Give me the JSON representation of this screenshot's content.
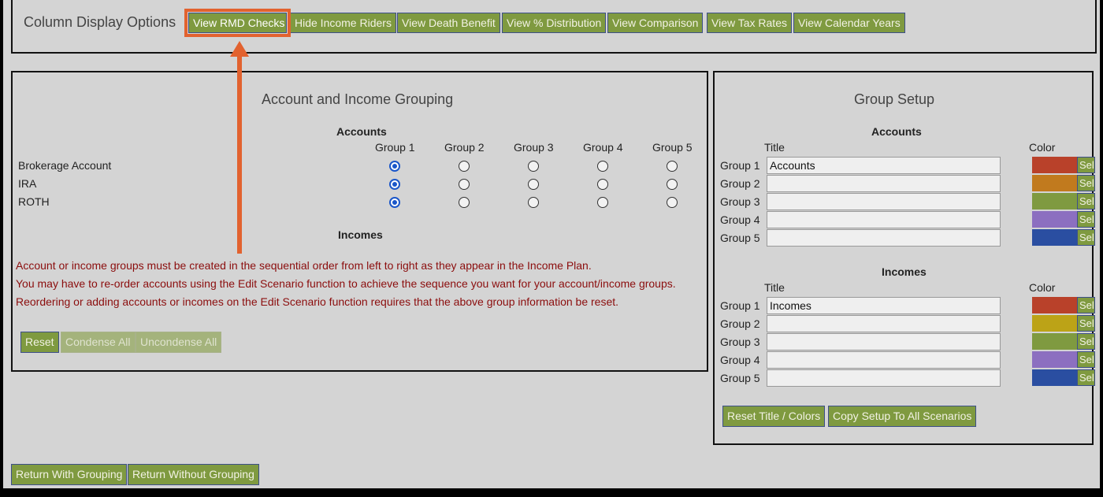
{
  "top_bar": {
    "label": "Column Display Options",
    "buttons": [
      "View RMD Checks",
      "Hide Income Riders",
      "View Death Benefit",
      "View % Distribution",
      "View Comparison",
      "View Tax Rates",
      "View Calendar Years"
    ]
  },
  "grouping": {
    "title": "Account and Income Grouping",
    "accounts_header": "Accounts",
    "group_headers": [
      "Group 1",
      "Group 2",
      "Group 3",
      "Group 4",
      "Group 5"
    ],
    "rows": [
      {
        "name": "Brokerage Account",
        "selected": 1
      },
      {
        "name": "IRA",
        "selected": 1
      },
      {
        "name": "ROTH",
        "selected": 1
      }
    ],
    "incomes_header": "Incomes",
    "warnings": [
      "Account or income groups must be created in the sequential order from left to right as they appear in the Income Plan.",
      "You may have to re-order accounts using the Edit Scenario function to achieve the sequence you want for your account/income groups.",
      "Reordering or adding accounts or incomes on the Edit Scenario function requires that the above group information be reset."
    ],
    "buttons": {
      "reset": "Reset",
      "condense": "Condense All",
      "uncondense": "Uncondense All"
    }
  },
  "setup": {
    "title": "Group Setup",
    "accounts_header": "Accounts",
    "incomes_header": "Incomes",
    "title_col": "Title",
    "color_col": "Color",
    "select_label": "Sel",
    "accounts": [
      {
        "label": "Group 1",
        "value": "Accounts",
        "color": "#b9412a"
      },
      {
        "label": "Group 2",
        "value": "",
        "color": "#c17a1e"
      },
      {
        "label": "Group 3",
        "value": "",
        "color": "#7f9a40"
      },
      {
        "label": "Group 4",
        "value": "",
        "color": "#8c6fc0"
      },
      {
        "label": "Group 5",
        "value": "",
        "color": "#2a4ea1"
      }
    ],
    "incomes": [
      {
        "label": "Group 1",
        "value": "Incomes",
        "color": "#b9412a"
      },
      {
        "label": "Group 2",
        "value": "",
        "color": "#bca317"
      },
      {
        "label": "Group 3",
        "value": "",
        "color": "#7f9a40"
      },
      {
        "label": "Group 4",
        "value": "",
        "color": "#8c6fc0"
      },
      {
        "label": "Group 5",
        "value": "",
        "color": "#2a4ea1"
      }
    ],
    "buttons": {
      "reset_colors": "Reset Title / Colors",
      "copy_setup": "Copy Setup To All Scenarios"
    }
  },
  "bottom": {
    "return_with": "Return With Grouping",
    "return_without": "Return Without Grouping"
  },
  "annotation": {
    "highlight_color": "#e2622f"
  }
}
